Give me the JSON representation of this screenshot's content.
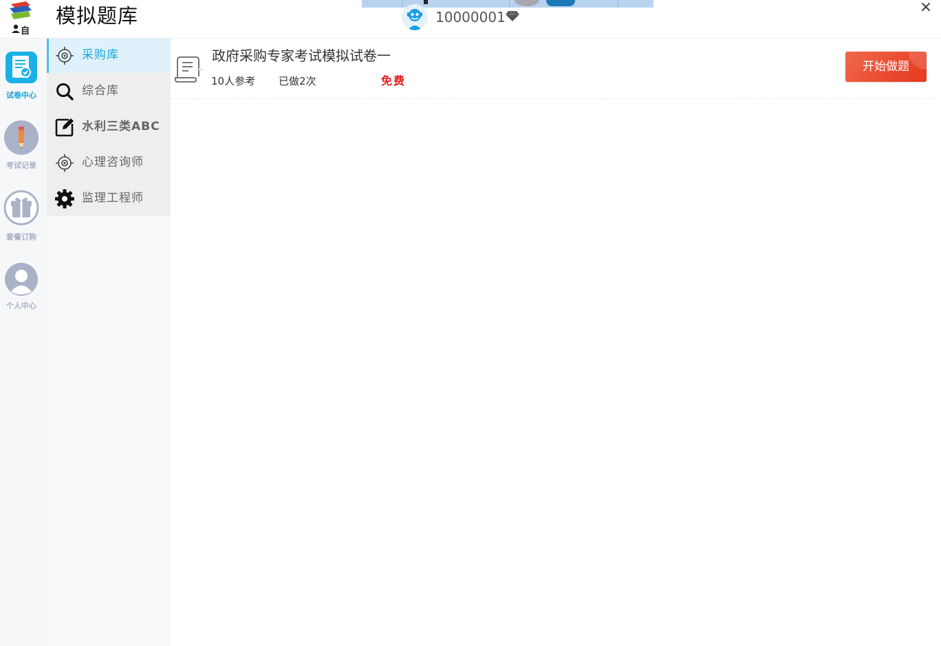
{
  "header": {
    "app_title": "模拟题库",
    "user_id": "10000001",
    "close_label": "×"
  },
  "rail": {
    "items": [
      {
        "label": "试卷中心",
        "icon": "exam-paper-icon",
        "active": true
      },
      {
        "label": "考试记录",
        "icon": "pencil-icon",
        "active": false
      },
      {
        "label": "套餐订购",
        "icon": "gift-icon",
        "active": false
      },
      {
        "label": "个人中心",
        "icon": "user-icon",
        "active": false
      }
    ]
  },
  "categories": {
    "items": [
      {
        "label": "采购库",
        "icon": "target-icon",
        "active": true
      },
      {
        "label": "综合库",
        "icon": "search-icon",
        "active": false
      },
      {
        "label": "水利三类ABC",
        "icon": "edit-icon",
        "active": false
      },
      {
        "label": "心理咨询师",
        "icon": "target-icon",
        "active": false
      },
      {
        "label": "监理工程师",
        "icon": "gear-icon",
        "active": false
      }
    ]
  },
  "exams": [
    {
      "title": "政府采购专家考试模拟试卷一",
      "participants": "10人参考",
      "done": "已做2次",
      "price": "免费",
      "action": "开始做题"
    }
  ],
  "colors": {
    "accent": "#1aa6df",
    "rail_inactive": "#a8b1c7",
    "free": "#e51c1c",
    "start_button": "#ea4a2e"
  }
}
